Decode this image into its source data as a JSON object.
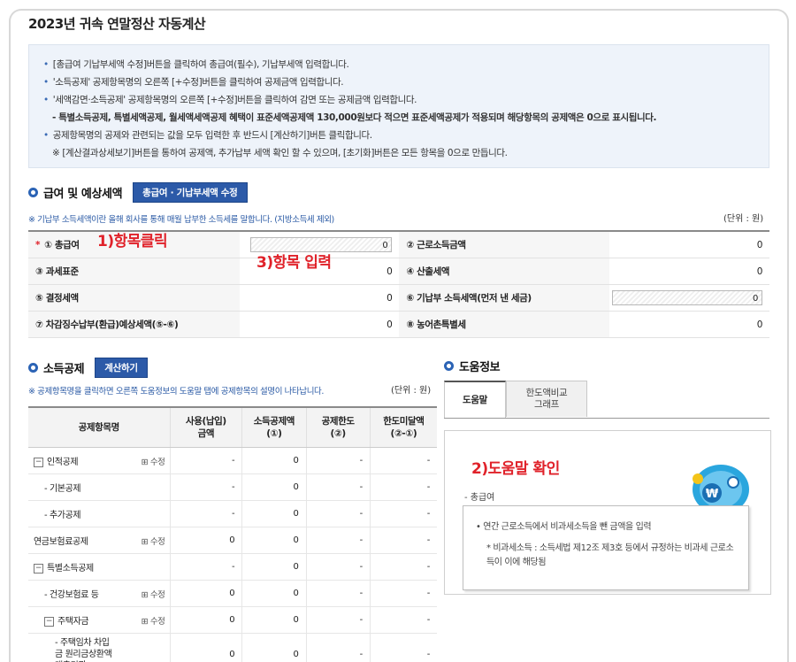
{
  "page": {
    "title": "2023년 귀속 연말정산 자동계산"
  },
  "notice": [
    {
      "text": "[총급여 기납부세액 수정]버튼을 클릭하여 총급여(필수), 기납부세액 입력합니다.",
      "bullet": true
    },
    {
      "text": "'소득공제' 공제항목명의 오른쪽 [+수정]버튼을 클릭하여 공제금액 입력합니다.",
      "bullet": true
    },
    {
      "text": "'세액감면·소득공제' 공제항목명의 오른쪽 [+수정]버튼을 클릭하여 감면 또는 공제금액 입력합니다.",
      "bullet": true
    },
    {
      "text": "- 특별소득공제, 특별세액공제, 월세액세액공제 혜택이 표준세액공제액 130,000원보다 적으면 표준세액공제가 적용되며 해당항목의 공제액은 0으로 표시됩니다.",
      "bullet": false
    },
    {
      "text": "공제항목명의 공제와 관련되는 값을 모두 입력한 후 반드시 [계산하기]버튼 클릭합니다.",
      "bullet": true
    },
    {
      "text": "※ [계산결과상세보기]버튼을 통하여 공제액, 추가납부 세액 확인 할 수 있으며, [초기화]버튼은 모든 항목을 0으로 만듭니다.",
      "bullet": false
    }
  ],
  "salary": {
    "section_title": "급여 및 예상세액",
    "edit_button": "총급여 · 기납부세액 수정",
    "note": "※ 기납부 소득세액이란 올해 회사를 통해 매월 납부한 소득세를 말합니다. (지방소득세 제외)",
    "unit": "(단위 : 원)",
    "rows": [
      {
        "l_star": "*",
        "l_label": "① 총급여",
        "l_value": "0",
        "r_label": "② 근로소득금액",
        "r_value": "0"
      },
      {
        "l_star": "",
        "l_label": "③ 과세표준",
        "l_value": "0",
        "r_label": "④ 산출세액",
        "r_value": "0"
      },
      {
        "l_star": "",
        "l_label": "⑤ 결정세액",
        "l_value": "0",
        "r_label": "⑥ 기납부 소득세액(먼저 낸 세금)",
        "r_value": "0"
      },
      {
        "l_star": "",
        "l_label": "⑦ 차감징수납부(환급)예상세액(⑤-⑥)",
        "l_value": "0",
        "r_label": "⑧ 농어촌특별세",
        "r_value": "0"
      }
    ]
  },
  "annotations": {
    "a1": "1)항목클릭",
    "a2": "2)도움말 확인",
    "a3": "3)항목 입력"
  },
  "deduction": {
    "section_title": "소득공제",
    "calc_button": "계산하기",
    "note": "※ 공제항목명을 클릭하면 오른쪽 도움정보의 도움말 탭에 공제항목의 설명이 나타납니다.",
    "unit": "(단위 : 원)",
    "headers": {
      "name": "공제항목명",
      "paid": "사용(납입)\n금액",
      "deduct": "소득공제액\n(①)",
      "limit": "공제한도\n(②)",
      "over": "한도미달액\n(②-①)"
    },
    "rows": [
      {
        "name": "인적공제",
        "toggle": "−",
        "indent": 0,
        "action": "⊞ 수정",
        "paid": "-",
        "deduct": "0",
        "limit": "-",
        "over": "-"
      },
      {
        "name": "- 기본공제",
        "toggle": "",
        "indent": 1,
        "action": "",
        "paid": "-",
        "deduct": "0",
        "limit": "-",
        "over": "-"
      },
      {
        "name": "- 추가공제",
        "toggle": "",
        "indent": 1,
        "action": "",
        "paid": "-",
        "deduct": "0",
        "limit": "-",
        "over": "-"
      },
      {
        "name": "연금보험료공제",
        "toggle": "",
        "indent": 0,
        "action": "⊞ 수정",
        "paid": "0",
        "deduct": "0",
        "limit": "-",
        "over": "-"
      },
      {
        "name": "특별소득공제",
        "toggle": "−",
        "indent": 0,
        "action": "",
        "paid": "-",
        "deduct": "0",
        "limit": "-",
        "over": "-"
      },
      {
        "name": "- 건강보험료 등",
        "toggle": "",
        "indent": 1,
        "action": "⊞ 수정",
        "paid": "0",
        "deduct": "0",
        "limit": "-",
        "over": "-"
      },
      {
        "name": "주택자금",
        "toggle": "−",
        "indent": 1,
        "action": "⊞ 수정",
        "paid": "0",
        "deduct": "0",
        "limit": "-",
        "over": "-"
      },
      {
        "name": "- 주택임차 차입금 원리금상환액 대출기관",
        "toggle": "",
        "indent": 2,
        "action": "",
        "paid": "0",
        "deduct": "0",
        "limit": "-",
        "over": "-"
      }
    ]
  },
  "help": {
    "section_title": "도움정보",
    "tabs": [
      "도움말",
      "한도액비교\n그래프"
    ],
    "item_title": "- 총급여",
    "lines": [
      "• 연간 근로소득에서 비과세소득을 뺀 금액을 입력",
      "* 비과세소득 : 소득세법 제12조 제3호 등에서 규정하는 비과세 근로소득이 이에 해당됨"
    ],
    "mascot_symbol": "₩"
  },
  "colors": {
    "accent": "#2c5aa8",
    "annotation_red": "#e0222a",
    "notice_bg": "#eef3fa"
  }
}
